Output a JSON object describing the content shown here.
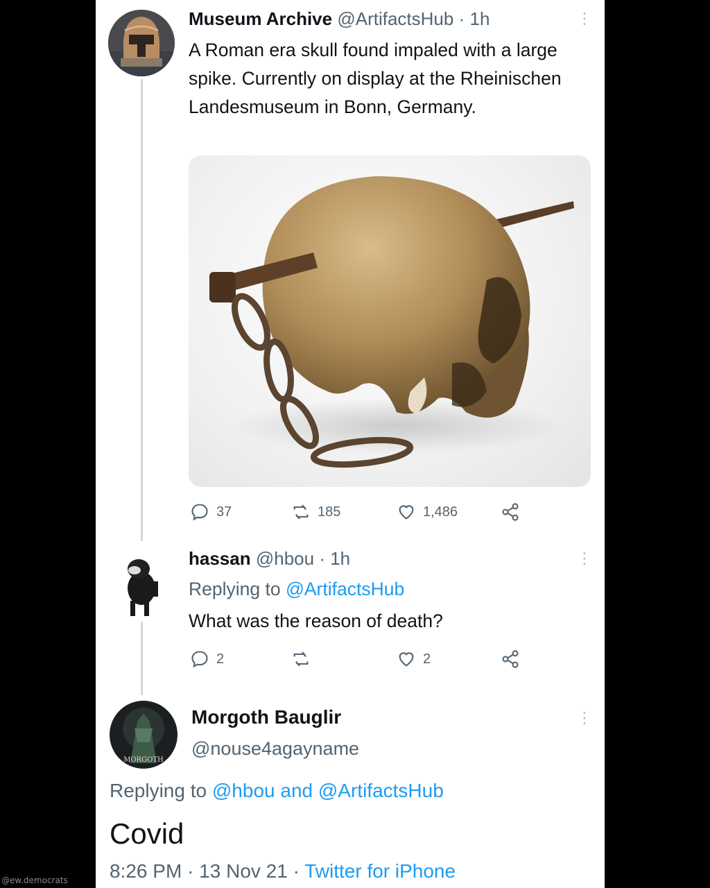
{
  "watermark": "@ew.democrats",
  "tweet1": {
    "display_name": "Museum Archive",
    "handle": "@ArtifactsHub",
    "separator": "·",
    "time": "1h",
    "text": "A Roman era skull found impaled with a large spike. Currently on display at the Rheinischen Landesmuseum in Bonn, Germany.",
    "media_icon": "photo-skull-with-spike-and-chain",
    "replies": "37",
    "retweets": "185",
    "likes": "1,486"
  },
  "tweet2": {
    "display_name": "hassan",
    "handle": "@hbou",
    "separator": "·",
    "time": "1h",
    "replying_prefix": "Replying to",
    "replying_to": "@ArtifactsHub",
    "text": "What was the reason of death?",
    "replies": "2",
    "retweets": "",
    "likes": "2"
  },
  "tweet3": {
    "display_name": "Morgoth Bauglir",
    "handle": "@nouse4agayname",
    "avatar_label": "MORGOTH",
    "replying_prefix": "Replying to",
    "replying_to_1": "@hbou",
    "replying_and": "and",
    "replying_to_2": "@ArtifactsHub",
    "text": "Covid",
    "time": "8:26 PM",
    "sep": "·",
    "date": "13 Nov 21",
    "source": "Twitter for iPhone"
  },
  "colors": {
    "link": "#1d9bf0",
    "muted": "#536471",
    "text": "#0f1419",
    "thread_line": "#cfd9de"
  }
}
